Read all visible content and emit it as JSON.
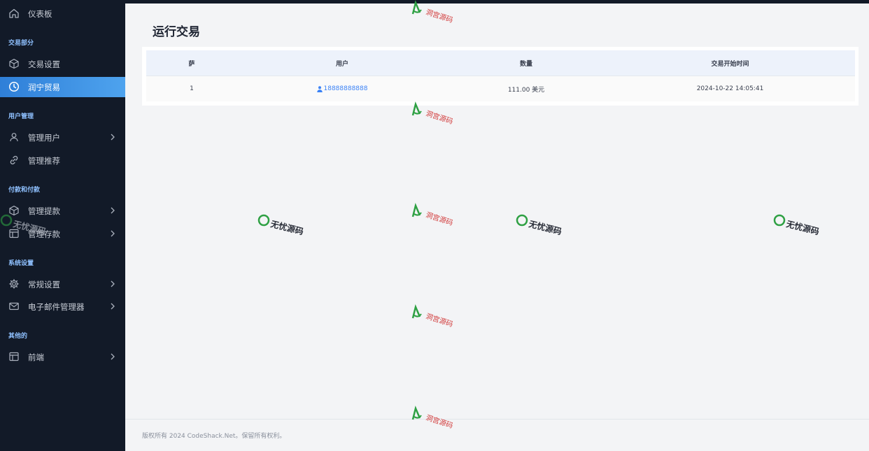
{
  "sidebar": {
    "dashboard": "仪表板",
    "sections": {
      "trade": "交易部分",
      "users": "用户管理",
      "payments": "付款和付款",
      "system": "系统设置",
      "other": "其他的"
    },
    "items": {
      "trade_settings": "交易设置",
      "runtrade": "润宁贸易",
      "manage_users": "管理用户",
      "manage_referrals": "管理推荐",
      "manage_withdrawals": "管理提款",
      "manage_deposits": "管理存款",
      "general_settings": "常规设置",
      "email_manager": "电子邮件管理器",
      "frontend": "前端"
    }
  },
  "page": {
    "title": "运行交易"
  },
  "table": {
    "headers": {
      "index": "萨",
      "user": "用户",
      "amount": "数量",
      "start_time": "交易开始时间"
    },
    "rows": [
      {
        "index": "1",
        "user": "18888888888",
        "amount": "111.00 美元",
        "start_time": "2024-10-22 14:05:41"
      }
    ]
  },
  "footer": {
    "text": "版权所有 2024 CodeShack.Net。保留所有权利。"
  },
  "watermarks": {
    "brand_a": "洞宫源码",
    "brand_b": "无忧源码"
  },
  "colors": {
    "sidebar_bg": "#121a28",
    "active_start": "#2f7fd8",
    "active_end": "#4ea3ee",
    "section_title": "#8fc1ff",
    "link": "#3b82f6"
  }
}
